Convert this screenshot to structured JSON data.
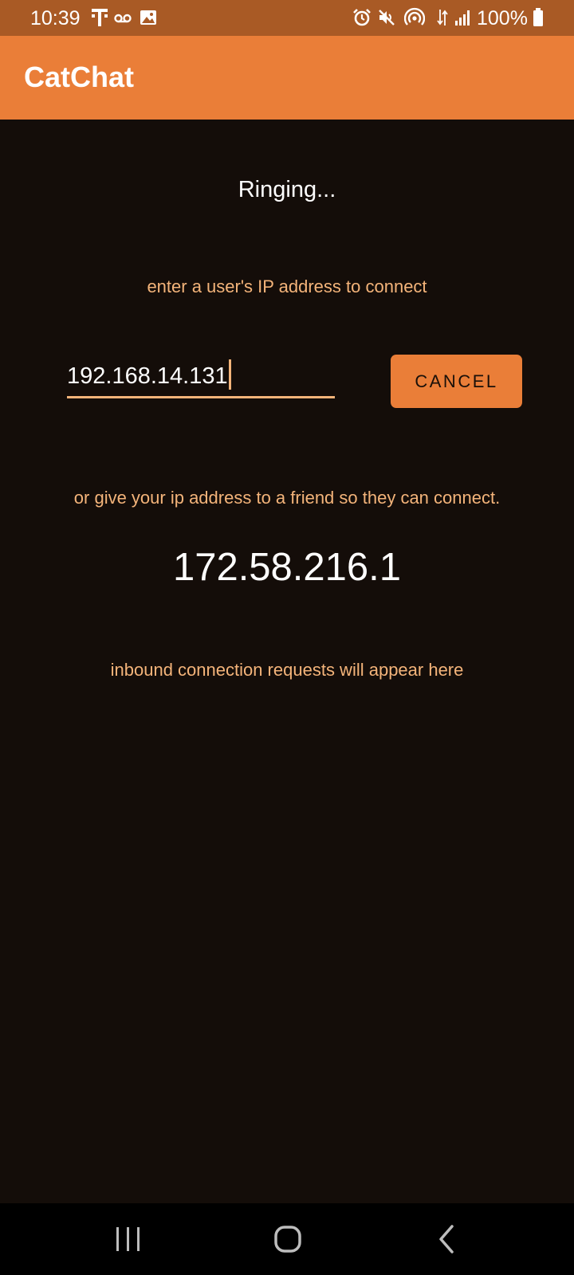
{
  "status_bar": {
    "time": "10:39",
    "battery": "100%",
    "icons": [
      "t-mobile-icon",
      "voicemail-icon",
      "image-icon",
      "alarm-icon",
      "mute-icon",
      "hotspot-icon",
      "data-icon",
      "signal-icon",
      "battery-icon"
    ]
  },
  "app_bar": {
    "title": "CatChat"
  },
  "main": {
    "status": "Ringing...",
    "connect_hint": "enter a user's IP address to connect",
    "ip_input_value": "192.168.14.131",
    "cancel_label": "CANCEL",
    "share_hint": "or give your ip address to a friend so they can connect.",
    "own_ip": "172.58.216.1",
    "inbound_hint": "inbound connection requests will appear here"
  },
  "nav_bar": {
    "buttons": [
      "recent-apps-icon",
      "home-icon",
      "back-icon"
    ]
  },
  "colors": {
    "status_bar": "#a95a25",
    "accent": "#ea7e38",
    "background": "#140d09",
    "hint_text": "#f4b47a"
  }
}
